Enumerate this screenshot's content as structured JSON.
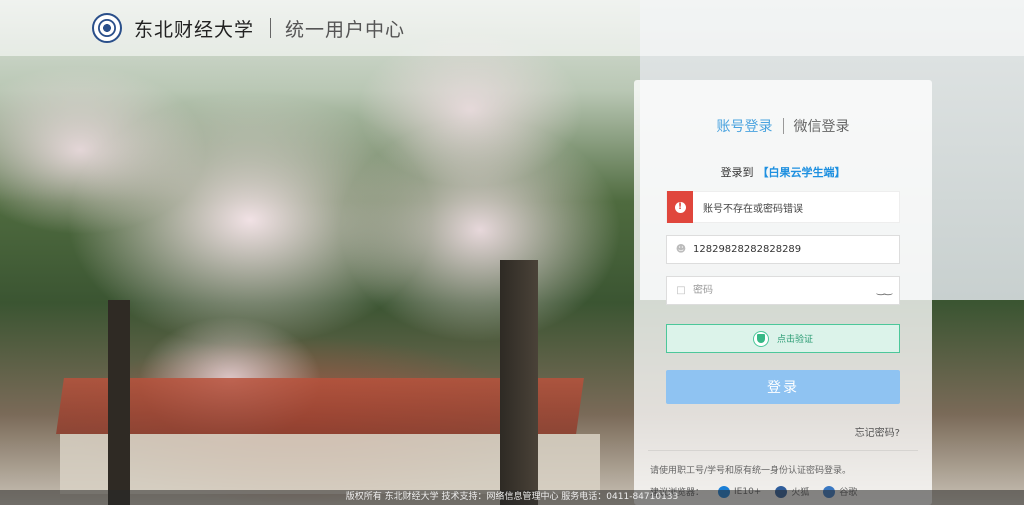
{
  "header": {
    "university_name": "东北财经大学",
    "system_name": "统一用户中心"
  },
  "login": {
    "tab_account": "账号登录",
    "tab_wechat": "微信登录",
    "login_to_prefix": "登录到",
    "login_to_app": "【白果云学生端】",
    "error_message": "账号不存在或密码错误",
    "username_value": "12829828282828289",
    "password_placeholder": "密码",
    "verify_label": "点击验证",
    "submit_label": "登录",
    "forgot_label": "忘记密码?",
    "hint": "请使用职工号/学号和原有统一身份认证密码登录。",
    "browsers_label": "建议浏览器：",
    "browsers": [
      "IE10+",
      "火狐",
      "谷歌"
    ]
  },
  "footer": {
    "text": "版权所有 东北财经大学 技术支持：网络信息管理中心 服务电话：0411-84710133"
  },
  "colors": {
    "accent": "#4aa3df",
    "error": "#e0463c",
    "verify": "#4cc79a",
    "button": "#8fc3f2"
  }
}
